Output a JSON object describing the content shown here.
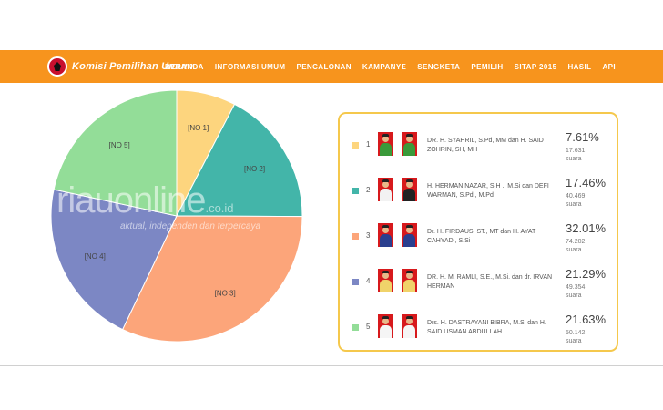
{
  "navbar": {
    "logo_text": "Komisi Pemilihan Umum",
    "menu": [
      "BERANDA",
      "INFORMASI UMUM",
      "PENCALONAN",
      "KAMPANYE",
      "SENGKETA",
      "PEMILIH",
      "SITAP 2015",
      "HASIL",
      "API"
    ],
    "color": "#f7941d"
  },
  "watermark": {
    "brand": "riauonline",
    "domain": ".co.id",
    "tagline": "aktual, independen dan terpercaya"
  },
  "chart_data": {
    "type": "pie",
    "categories": [
      "[NO 1]",
      "[NO 2]",
      "[NO 3]",
      "[NO 4]",
      "[NO 5]"
    ],
    "values": [
      7.61,
      17.46,
      32.01,
      21.29,
      21.63
    ],
    "colors": [
      "#fdd57e",
      "#43b5a9",
      "#fca57a",
      "#7c87c4",
      "#93dd98"
    ],
    "title": "",
    "legend": "right"
  },
  "results": [
    {
      "no": "1",
      "color": "#fdd57e",
      "names": "DR. H. SYAHRIL, S.Pd, MM dan H. SAID ZOHRIN, SH, MH",
      "percent": "7.61%",
      "votes": "17.631",
      "unit": "suara"
    },
    {
      "no": "2",
      "color": "#43b5a9",
      "names": "H. HERMAN NAZAR, S.H ., M.Si dan DEFI WARMAN, S.Pd., M.Pd",
      "percent": "17.46%",
      "votes": "40.469",
      "unit": "suara"
    },
    {
      "no": "3",
      "color": "#fca57a",
      "names": "Dr. H. FIRDAUS, ST., MT dan H. AYAT CAHYADI, S.Si",
      "percent": "32.01%",
      "votes": "74.202",
      "unit": "suara"
    },
    {
      "no": "4",
      "color": "#7c87c4",
      "names": "DR. H. M. RAMLI, S.E., M.Si. dan dr. IRVAN HERMAN",
      "percent": "21.29%",
      "votes": "49.354",
      "unit": "suara"
    },
    {
      "no": "5",
      "color": "#93dd98",
      "names": "Drs. H. DASTRAYANI BIBRA, M.Si dan H. SAID USMAN ABDULLAH",
      "percent": "21.63%",
      "votes": "50.142",
      "unit": "suara"
    }
  ]
}
